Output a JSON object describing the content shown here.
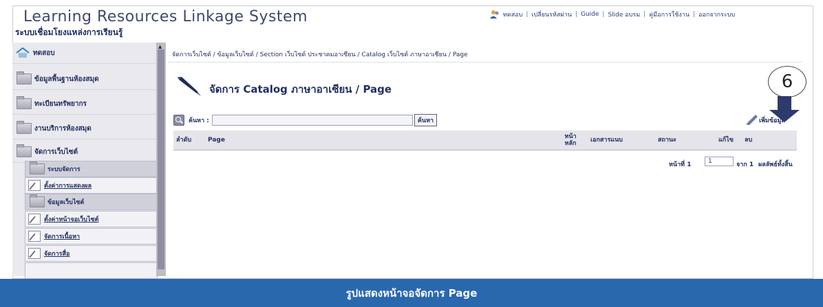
{
  "header": {
    "title": "Learning Resources Linkage System",
    "subtitle": "ระบบเชื่อมโยงแหล่งการเรียนรู้",
    "links": [
      "ทดสอบ",
      "เปลี่ยนรหัสผ่าน",
      "Guide",
      "Slide อบรม",
      "คู่มือการใช้งาน",
      "ออกจากระบบ"
    ]
  },
  "sidebar": {
    "items": [
      {
        "label": "ทดสอบ"
      },
      {
        "label": "ข้อมูลพื้นฐานห้องสมุด"
      },
      {
        "label": "ทะเบียนทรัพยากร"
      },
      {
        "label": "งานบริการห้องสมุด"
      },
      {
        "label": "จัดการเว็บไซต์"
      }
    ],
    "subitems": [
      {
        "label": "ระบบจัดการ"
      },
      {
        "label": "ตั้งค่าการแสดงผล"
      },
      {
        "label": "ข้อมูลเว็บไซต์"
      },
      {
        "label": "ตั้งค่าหน้าจอเว็บไซต์"
      },
      {
        "label": "จัดการเนื้อหา"
      },
      {
        "label": "จัดการสื่อ"
      }
    ]
  },
  "main": {
    "breadcrumb": "จัดการเว็บไซต์ / ข้อมูลเว็บไซต์ / Section เว็บไซต์ ประชาคมอาเซียน / Catalog เว็บไซต์ ภาษาอาเซียน / Page",
    "page_title": "จัดการ Catalog ภาษาอาเซียน / Page",
    "search": {
      "label": "ค้นหา :",
      "value": "",
      "button": "ค้นหา"
    },
    "add_label": "เพิ่มข้อมูล",
    "table": {
      "columns": [
        "ลำดับ",
        "Page",
        "หน้า หลัก",
        "เอกสารแนบ",
        "สถานะ",
        "แก้ไข",
        "ลบ"
      ]
    },
    "pager": {
      "page_label": "หน้าที่ 1",
      "page_value": "1",
      "of_label": "จาก 1",
      "total_label": "ผลลัพธ์ทั้งสิ้น"
    }
  },
  "annotation": {
    "number": "6"
  },
  "caption": "รูปแสดงหน้าจอจัดการ Page",
  "colors": {
    "caption_bar": "#2a68ae",
    "text": "#223061",
    "sidebar": "#e9e9ee"
  }
}
